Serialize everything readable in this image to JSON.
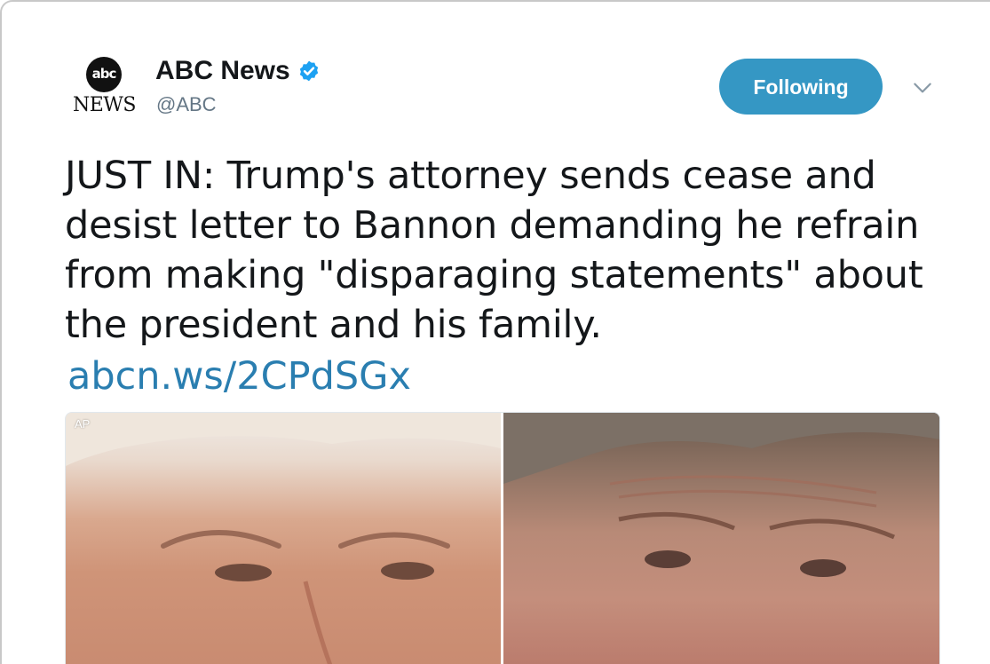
{
  "account": {
    "logo_top": "abc",
    "logo_bottom": "NEWS",
    "name": "ABC News",
    "verified_icon": "verified-badge-icon",
    "handle": "@ABC"
  },
  "actions": {
    "follow_label": "Following",
    "follow_color": "#3597c4",
    "menu_icon": "chevron-down-icon"
  },
  "tweet": {
    "text": "JUST IN: Trump's attorney sends cease and desist letter to Bannon demanding he refrain from making \"disparaging statements\" about the president and his family.",
    "link": "abcn.ws/2CPdSGx",
    "link_color": "#2a7eb0"
  },
  "media": {
    "credit": "AP",
    "left_photo": "photo of a man's face (left)",
    "right_photo": "photo of a man's face (right)"
  }
}
